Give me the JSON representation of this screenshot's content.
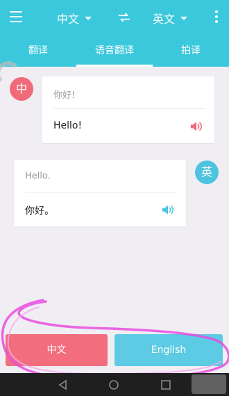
{
  "header": {
    "source_lang": "中文",
    "target_lang": "英文",
    "menu_icon": "hamburger-menu-icon",
    "swap_icon": "swap-arrows-icon",
    "more_icon": "more-vertical-icon"
  },
  "tabs": [
    {
      "label": "翻译",
      "active": false
    },
    {
      "label": "语音翻译",
      "active": true
    },
    {
      "label": "拍译",
      "active": false
    }
  ],
  "conversation": [
    {
      "speaker_label": "中",
      "source_text": "你好!",
      "translation": "Hello!",
      "speaker_color": "#f06a7a"
    },
    {
      "speaker_label": "英",
      "source_text": "Hello.",
      "translation": "你好。",
      "speaker_color": "#4ec3e0"
    }
  ],
  "buttons": {
    "chinese": "中文",
    "english": "English"
  },
  "colors": {
    "primary": "#3cc8dc",
    "chinese_accent": "#f26d7d",
    "english_accent": "#5ccbe3",
    "background": "#f0eef2",
    "annotation": "#e84de0"
  }
}
